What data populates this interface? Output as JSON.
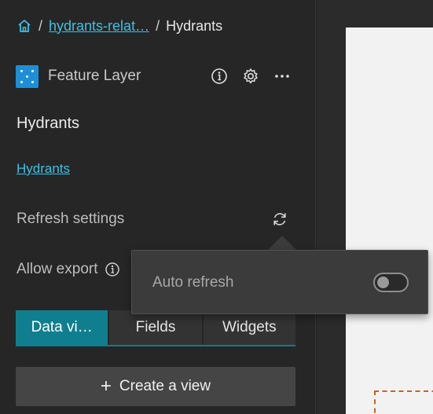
{
  "breadcrumb": {
    "home_icon": "home-icon",
    "separator": "/",
    "parent_link": "hydrants-relat…",
    "current": "Hydrants"
  },
  "item": {
    "type_label": "Feature Layer",
    "thumbnail_color": "#1e8fd6",
    "icons": [
      "info-icon",
      "gear-icon",
      "more-icon"
    ]
  },
  "layer": {
    "title": "Hydrants",
    "link": "Hydrants"
  },
  "settings": {
    "refresh_label": "Refresh settings",
    "export_label": "Allow export"
  },
  "tabs": [
    {
      "label": "Data vi…",
      "active": true
    },
    {
      "label": "Fields",
      "active": false
    },
    {
      "label": "Widgets",
      "active": false
    }
  ],
  "actions": {
    "create_view_label": "Create a view"
  },
  "popover": {
    "auto_refresh_label": "Auto refresh",
    "auto_refresh_on": false
  },
  "colors": {
    "accent": "#0f7f8f",
    "link": "#3bc2e3",
    "selection_outline": "#c9621c"
  }
}
